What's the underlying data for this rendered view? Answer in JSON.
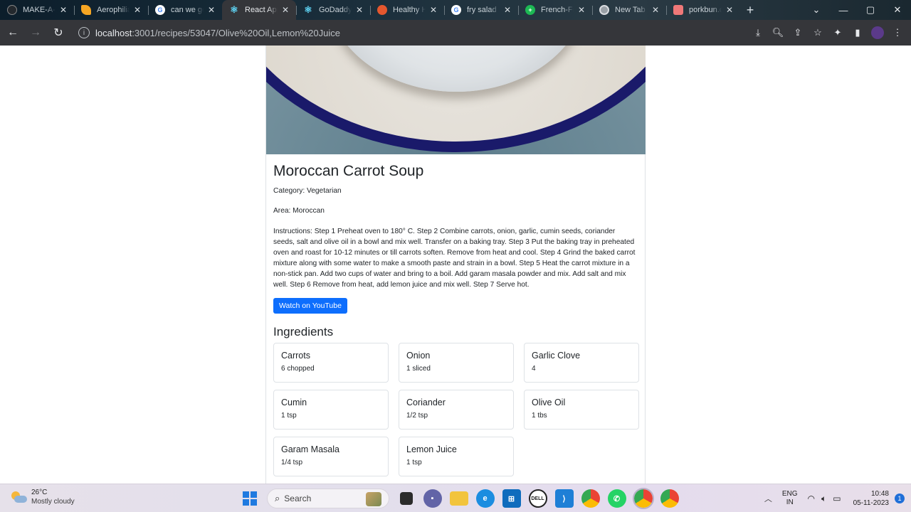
{
  "browser": {
    "tabs": [
      {
        "title": "MAKE-A-T",
        "icon": "github-icon",
        "color": "#24292e",
        "active": false
      },
      {
        "title": "Aerophilia",
        "icon": "firebase-icon",
        "color": "#f6a623",
        "active": false
      },
      {
        "title": "can we ge",
        "icon": "google-icon",
        "color": "#4285f4",
        "active": false
      },
      {
        "title": "React App",
        "icon": "react-icon",
        "color": "#61dafb",
        "active": true
      },
      {
        "title": "GoDaddy",
        "icon": "react-icon",
        "color": "#61dafb",
        "active": false
      },
      {
        "title": "Healthy H",
        "icon": "app-icon",
        "color": "#e4572e",
        "active": false
      },
      {
        "title": "fry salad",
        "icon": "google-icon",
        "color": "#4285f4",
        "active": false
      },
      {
        "title": "French-Fr",
        "icon": "plus-icon",
        "color": "#1db954",
        "active": false
      },
      {
        "title": "New Tab",
        "icon": "chrome-icon",
        "color": "#9aa0a6",
        "active": false
      },
      {
        "title": "porkbun.c",
        "icon": "porkbun-icon",
        "color": "#ef7878",
        "active": false
      }
    ],
    "url_host": "localhost",
    "url_rest": ":3001/recipes/53047/Olive%20Oil,Lemon%20Juice"
  },
  "recipe": {
    "title": "Moroccan Carrot Soup",
    "category": "Category: Vegetarian",
    "area": "Area: Moroccan",
    "instructions": "Instructions: Step 1 Preheat oven to 180° C. Step 2 Combine carrots, onion, garlic, cumin seeds, coriander seeds, salt and olive oil in a bowl and mix well. Transfer on a baking tray. Step 3 Put the baking tray in preheated oven and roast for 10-12 minutes or till carrots soften. Remove from heat and cool. Step 4 Grind the baked carrot mixture along with some water to make a smooth paste and strain in a bowl. Step 5 Heat the carrot mixture in a non-stick pan. Add two cups of water and bring to a boil. Add garam masala powder and mix. Add salt and mix well. Step 6 Remove from heat, add lemon juice and mix well. Step 7 Serve hot.",
    "youtube_label": "Watch on YouTube",
    "ingredients_heading": "Ingredients",
    "ingredients": [
      {
        "name": "Carrots",
        "measure": "6 chopped"
      },
      {
        "name": "Onion",
        "measure": "1 sliced"
      },
      {
        "name": "Garlic Clove",
        "measure": "4"
      },
      {
        "name": "Cumin",
        "measure": "1 tsp"
      },
      {
        "name": "Coriander",
        "measure": "1/2 tsp"
      },
      {
        "name": "Olive Oil",
        "measure": "1 tbs"
      },
      {
        "name": "Garam Masala",
        "measure": "1/4 tsp"
      },
      {
        "name": "Lemon Juice",
        "measure": "1 tsp"
      }
    ],
    "accent_color": "#0d6efd"
  },
  "taskbar": {
    "weather_temp": "26°C",
    "weather_condition": "Mostly cloudy",
    "search_placeholder": "Search",
    "lang_top": "ENG",
    "lang_bottom": "IN",
    "time": "10:48",
    "date": "05-11-2023",
    "notification_count": "1"
  }
}
